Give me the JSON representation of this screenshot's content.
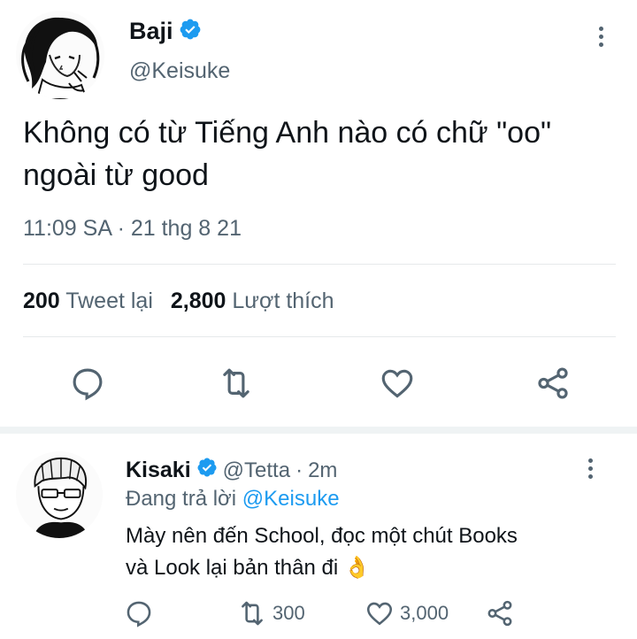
{
  "main_tweet": {
    "author_name": "Baji",
    "author_handle": "@Keisuke",
    "text_line1": "Không có từ Tiếng Anh nào có chữ \"oo\"",
    "text_line2": "ngoài từ good",
    "time": "11:09 SA",
    "separator": "·",
    "date": "21 thg 8 21",
    "retweet_count": "200",
    "retweet_label": "Tweet lại",
    "like_count": "2,800",
    "like_label": "Lượt thích"
  },
  "reply": {
    "author_name": "Kisaki",
    "author_handle": "@Tetta",
    "separator": "·",
    "time_ago": "2m",
    "replying_prefix": "Đang trả lời",
    "replying_to": "@Keisuke",
    "text_line1": "Mày nên đến School, đọc một chút Books",
    "text_line2": "và Look lại bản thân đi",
    "emoji": "👌",
    "retweet_count": "300",
    "like_count": "3,000"
  },
  "icons": {
    "verified": "verified-badge-icon",
    "more": "more-vertical-icon",
    "reply": "reply-bubble-icon",
    "retweet": "retweet-icon",
    "like": "heart-icon",
    "share": "share-icon",
    "emoji": "ok-hand-emoji"
  },
  "colors": {
    "accent": "#1d9bf0",
    "text": "#0f1419",
    "muted": "#536471",
    "divider": "#e6e9eb",
    "section_gap": "#eff3f4"
  }
}
